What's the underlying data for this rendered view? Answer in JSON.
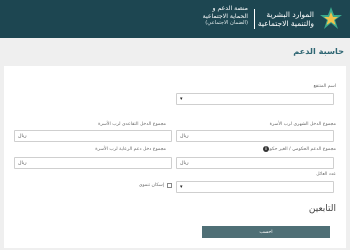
{
  "header": {
    "brand_lines": [
      "الموارد البشرية",
      "والتنمية الاجتماعية"
    ],
    "platform_lines": [
      "منصة الدعم و",
      "الحماية الاجتماعية",
      "(الضمان الاجتماعي)"
    ]
  },
  "page": {
    "title": "حاسبة الدعم"
  },
  "form": {
    "beneficiary_name_label": "اسم المنتفع",
    "monthly_income_label": "مجموع الدخل الشهري لرب الأسرة",
    "retirement_income_label": "مجموع الدخل التقاعدي لرب الأسرة",
    "subsidy_income_label": "مجموع الدعم الحكومي / الغير حكومي",
    "social_support_label": "مجموع دخل دعم الرعاية لرب الأسرة",
    "dependents_label": "عدد العائل",
    "currency_unit": "ريال",
    "info_glyph": "i",
    "checkbox_label": "إسكان تنموي",
    "dropdown_glyph": "▾",
    "dependents_section_title": "التابعين",
    "submit_label": "احسب"
  },
  "colors": {
    "header_bg": "#1d4651",
    "title": "#2f6673",
    "button": "#4f6f76",
    "logo_green": "#3aaa8c",
    "logo_yellow": "#f1c24b"
  }
}
